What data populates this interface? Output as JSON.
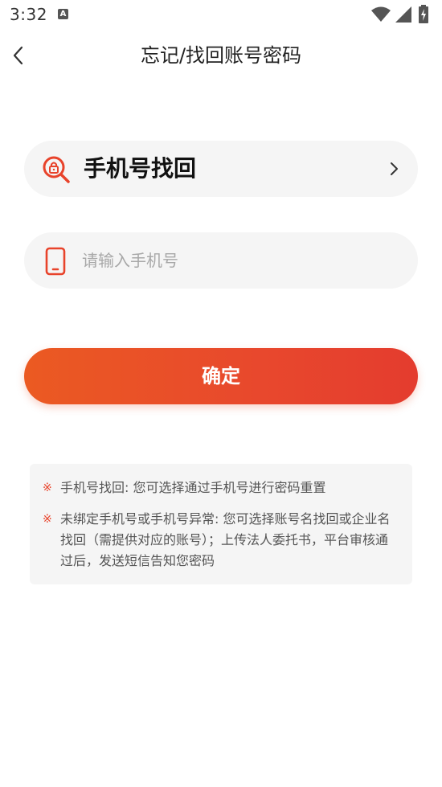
{
  "status_bar": {
    "time": "3:32",
    "notification_icon": "a-icon",
    "icons": [
      "wifi-icon",
      "signal-icon",
      "battery-charging-icon"
    ]
  },
  "header": {
    "title": "忘记/找回账号密码",
    "back_icon": "chevron-left-icon"
  },
  "method": {
    "label": "手机号找回",
    "icon": "search-lock-icon",
    "chevron_icon": "chevron-right-icon"
  },
  "phone": {
    "placeholder": "请输入手机号",
    "value": "",
    "icon": "phone-icon"
  },
  "confirm": {
    "label": "确定"
  },
  "notes": {
    "mark": "※",
    "items": [
      "手机号找回: 您可选择通过手机号进行密码重置",
      "未绑定手机号或手机号异常: 您可选择账号名找回或企业名找回（需提供对应的账号）；上传法人委托书，平台审核通过后，发送短信告知您密码"
    ]
  },
  "colors": {
    "accent": "#e8482d",
    "gradient_start": "#eb5a22",
    "gradient_end": "#e43c2e",
    "field_bg": "#f5f5f5",
    "mark": "#e8432b"
  }
}
